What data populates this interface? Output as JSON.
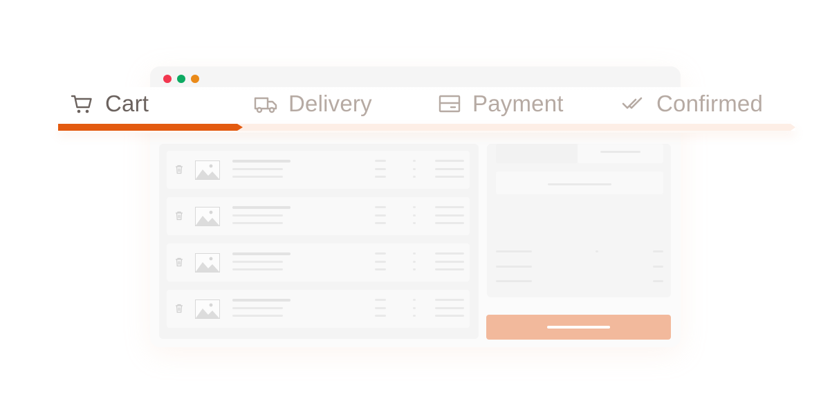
{
  "window": {
    "controls": [
      {
        "name": "close",
        "color": "#f2374f"
      },
      {
        "name": "minimize",
        "color": "#0daa62"
      },
      {
        "name": "maximize",
        "color": "#ea8a19"
      }
    ]
  },
  "stepper": {
    "steps": [
      {
        "label": "Cart",
        "icon": "cart-icon",
        "state": "active"
      },
      {
        "label": "Delivery",
        "icon": "truck-icon",
        "state": "pending"
      },
      {
        "label": "Payment",
        "icon": "card-icon",
        "state": "pending"
      },
      {
        "label": "Confirmed",
        "icon": "double-check-icon",
        "state": "pending"
      }
    ],
    "progress": 0.25,
    "colors": {
      "active_bar": "#e35a0f",
      "inactive_bar": "#fdeee6",
      "active_text": "#6b625e",
      "inactive_text": "#b6aaa3"
    }
  },
  "cart": {
    "items_count": 4,
    "checkout_button_color": "#f2b99c"
  }
}
